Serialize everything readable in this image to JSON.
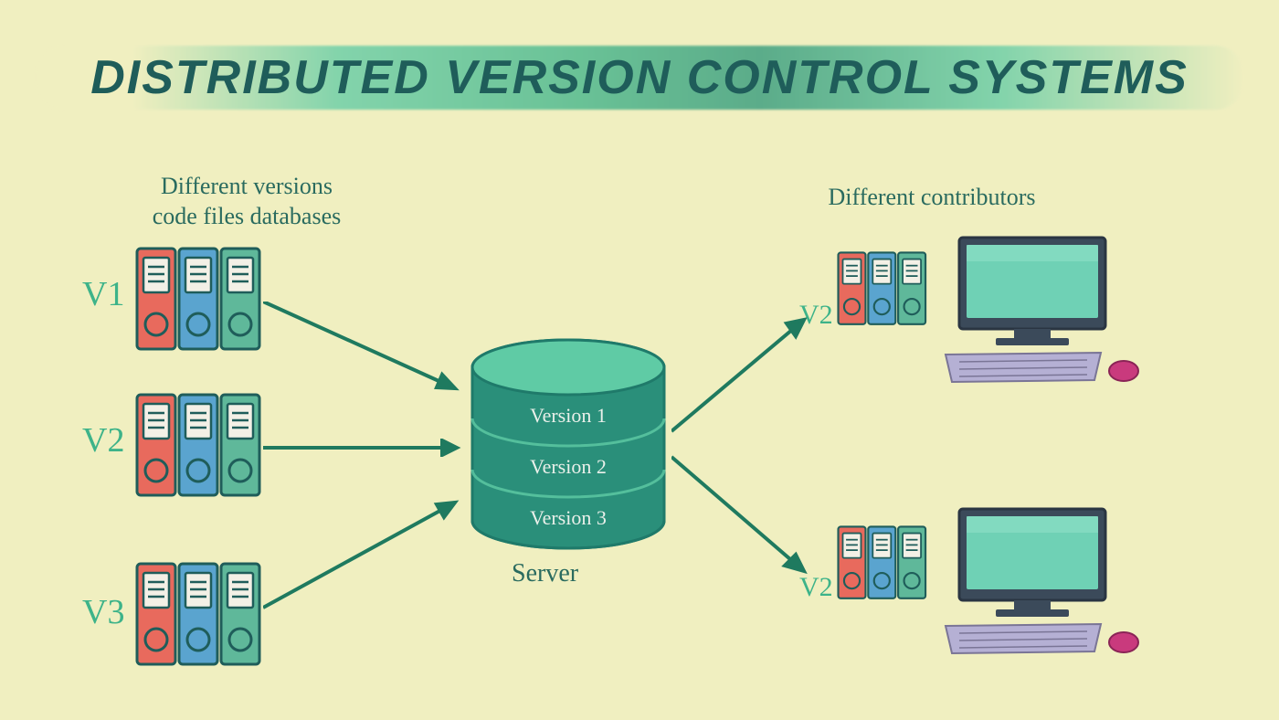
{
  "title": "DISTRIBUTED VERSION CONTROL SYSTEMS",
  "subtitles": {
    "left_line1": "Different versions",
    "left_line2": "code files databases",
    "right": "Different contributors"
  },
  "versions": {
    "v1": "V1",
    "v2": "V2",
    "v3": "V3",
    "contrib1": "V2",
    "contrib2": "V2"
  },
  "server": {
    "label": "Server",
    "slots": [
      "Version 1",
      "Version 2",
      "Version 3"
    ]
  },
  "colors": {
    "binder_red": "#e86a5d",
    "binder_blue": "#5aa4cf",
    "binder_green": "#5fb89a",
    "db_top": "#5fcba5",
    "db_side": "#2a8f7a",
    "db_dark": "#1f7a6a",
    "screen": "#6fd1b5",
    "kb": "#b5b0d4",
    "mouse": "#c93a7d",
    "arrow": "#1f7a5f"
  }
}
